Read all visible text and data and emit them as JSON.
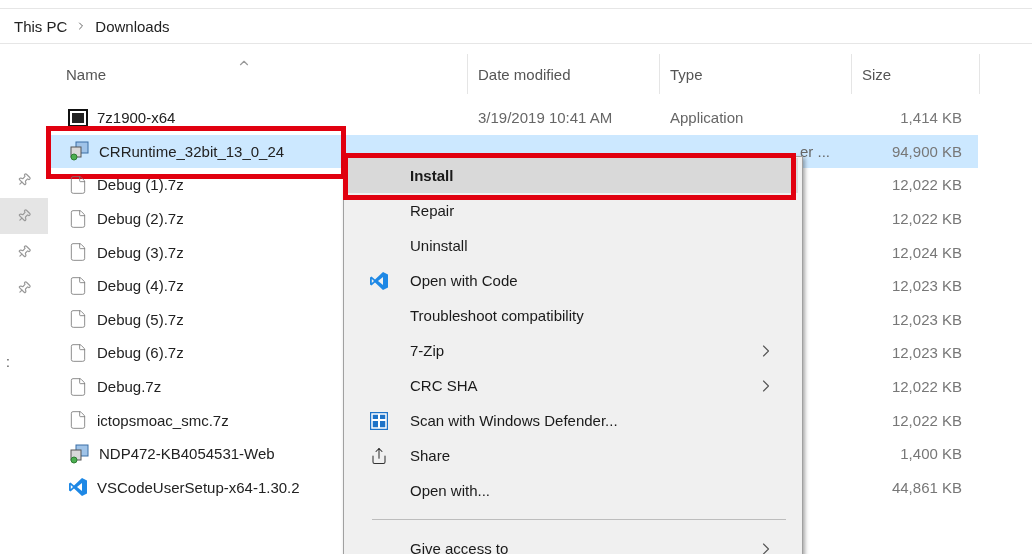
{
  "breadcrumb": [
    "This PC",
    "Downloads"
  ],
  "quick_access": [
    {
      "selected": false
    },
    {
      "selected": true
    },
    {
      "selected": false
    },
    {
      "selected": false
    }
  ],
  "sidebar_text": ":",
  "columns": [
    {
      "label": "Name",
      "sorted": true
    },
    {
      "label": "Date modified",
      "sorted": false
    },
    {
      "label": "Type",
      "sorted": false
    },
    {
      "label": "Size",
      "sorted": false
    }
  ],
  "files": [
    {
      "name": "7z1900-x64",
      "kind": "archive",
      "date": "3/19/2019 10:41 AM",
      "type": "Application",
      "size": "1,414 KB",
      "selected": false,
      "outlined": false
    },
    {
      "name": "CRRuntime_32bit_13_0_24",
      "kind": "installer",
      "type": "er ...",
      "size": "94,900 KB",
      "selected": true,
      "outlined": true
    },
    {
      "name": "Debug (1).7z",
      "kind": "blank",
      "size": "12,022 KB",
      "selected": false,
      "outlined": false
    },
    {
      "name": "Debug (2).7z",
      "kind": "blank",
      "size": "12,022 KB",
      "selected": false,
      "outlined": false
    },
    {
      "name": "Debug (3).7z",
      "kind": "blank",
      "size": "12,024 KB",
      "selected": false,
      "outlined": false
    },
    {
      "name": "Debug (4).7z",
      "kind": "blank",
      "size": "12,023 KB",
      "selected": false,
      "outlined": false
    },
    {
      "name": "Debug (5).7z",
      "kind": "blank",
      "size": "12,023 KB",
      "selected": false,
      "outlined": false
    },
    {
      "name": "Debug (6).7z",
      "kind": "blank",
      "size": "12,023 KB",
      "selected": false,
      "outlined": false
    },
    {
      "name": "Debug.7z",
      "kind": "blank",
      "size": "12,022 KB",
      "selected": false,
      "outlined": false
    },
    {
      "name": "ictopsmoac_smc.7z",
      "kind": "blank",
      "size": "12,022 KB",
      "selected": false,
      "outlined": false
    },
    {
      "name": "NDP472-KB4054531-Web",
      "kind": "installer",
      "size": "1,400 KB",
      "selected": false,
      "outlined": false
    },
    {
      "name": "VSCodeUserSetup-x64-1.30.2",
      "kind": "vscode",
      "size": "44,861 KB",
      "selected": false,
      "outlined": false
    }
  ],
  "context_menu": [
    {
      "kind": "item",
      "label": "Install",
      "bold": true,
      "selected": true,
      "outlined": true,
      "submenu": false
    },
    {
      "kind": "item",
      "label": "Repair",
      "bold": false,
      "selected": false,
      "outlined": false,
      "submenu": false
    },
    {
      "kind": "item",
      "label": "Uninstall",
      "bold": false,
      "selected": false,
      "outlined": false,
      "submenu": false
    },
    {
      "kind": "vscode",
      "label": "Open with Code",
      "bold": false,
      "selected": false,
      "outlined": false,
      "submenu": false
    },
    {
      "kind": "item",
      "label": "Troubleshoot compatibility",
      "bold": false,
      "selected": false,
      "outlined": false,
      "submenu": false
    },
    {
      "kind": "item",
      "label": "7-Zip",
      "bold": false,
      "selected": false,
      "outlined": false,
      "submenu": true
    },
    {
      "kind": "item",
      "label": "CRC SHA",
      "bold": false,
      "selected": false,
      "outlined": false,
      "submenu": true
    },
    {
      "kind": "shield",
      "label": "Scan with Windows Defender...",
      "bold": false,
      "selected": false,
      "outlined": false,
      "submenu": false
    },
    {
      "kind": "share",
      "label": "Share",
      "bold": false,
      "selected": false,
      "outlined": false,
      "submenu": false
    },
    {
      "kind": "item",
      "label": "Open with...",
      "bold": false,
      "selected": false,
      "outlined": false,
      "submenu": false
    },
    {
      "kind": "separator"
    },
    {
      "kind": "item",
      "label": "Give access to",
      "bold": false,
      "selected": false,
      "outlined": false,
      "submenu": true
    }
  ]
}
